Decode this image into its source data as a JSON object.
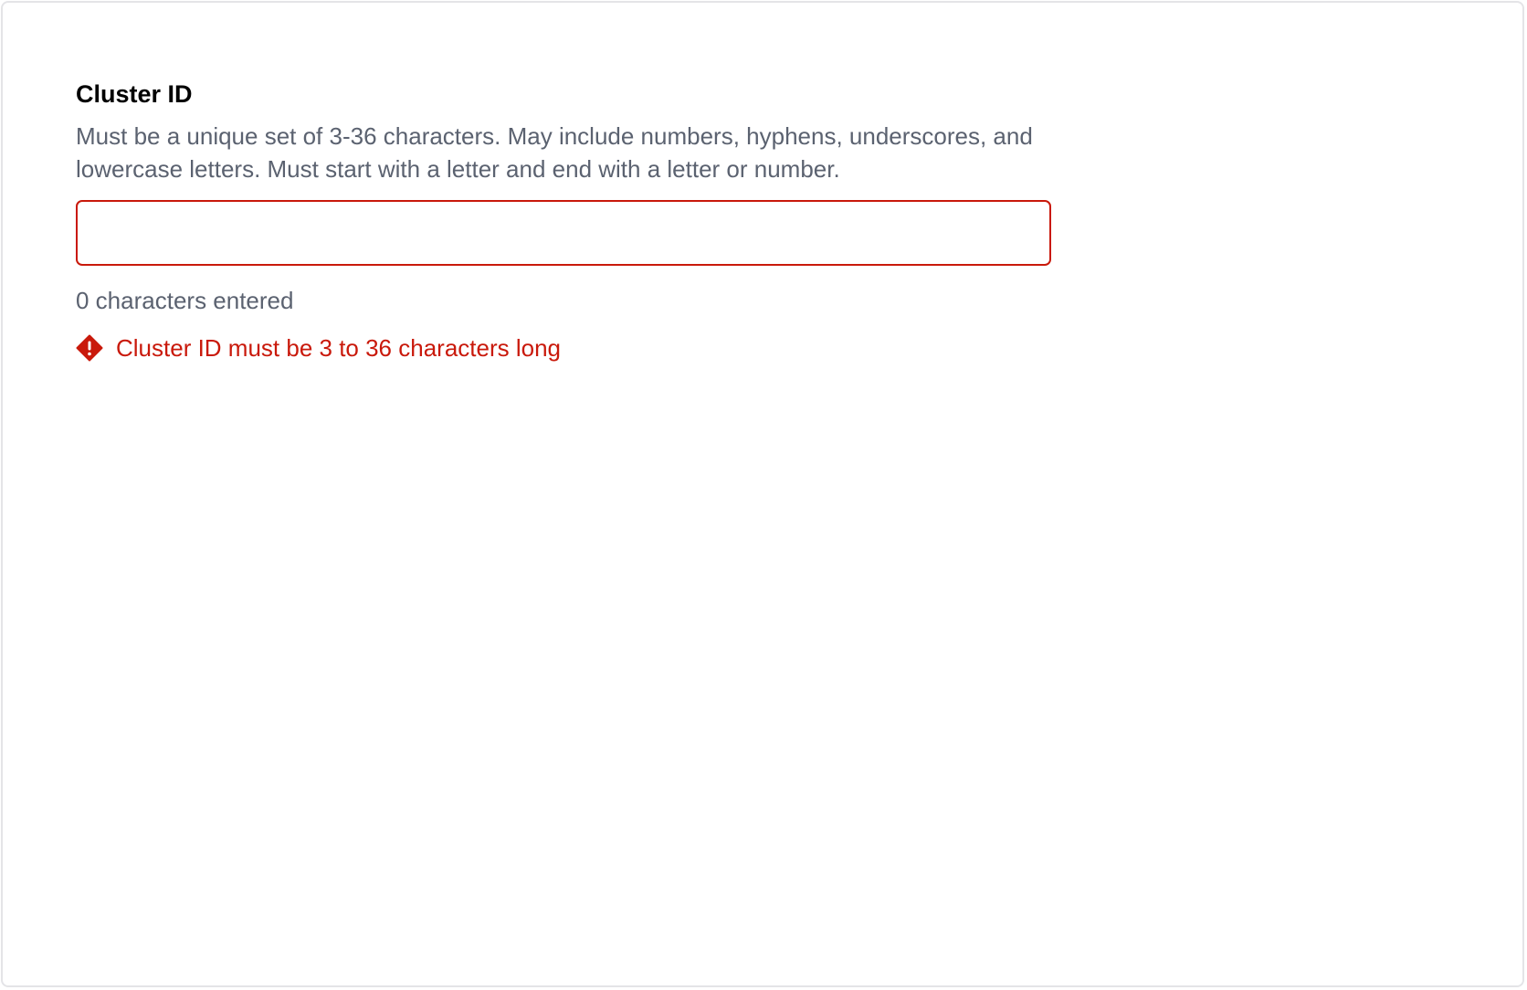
{
  "field": {
    "label": "Cluster ID",
    "help_text": "Must be a unique set of 3-36 characters. May include numbers, hyphens, underscores, and lowercase letters. Must start with a letter and end with a letter or number.",
    "input_value": "",
    "input_placeholder": "",
    "char_count_text": "0 characters entered",
    "error_icon": "exclamation-diamond-icon",
    "error_text": "Cluster ID must be 3 to 36 characters long"
  },
  "colors": {
    "error": "#c9190b",
    "help_text": "#5b6270",
    "label": "#000000",
    "frame_border": "#e4e4e7"
  }
}
